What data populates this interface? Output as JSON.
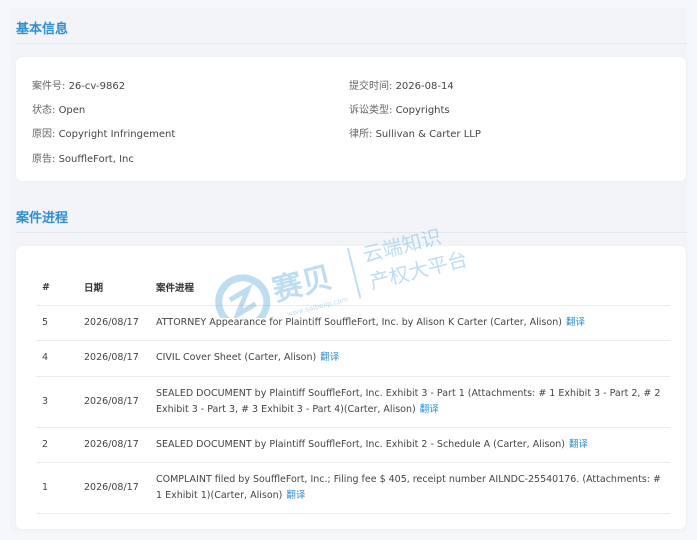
{
  "basic_info": {
    "title": "基本信息",
    "case_no": {
      "label": "案件号:",
      "value": "26-cv-9862"
    },
    "filed": {
      "label": "提交时间:",
      "value": "2026-08-14"
    },
    "status": {
      "label": "状态:",
      "value": "Open"
    },
    "suit_type": {
      "label": "诉讼类型:",
      "value": "Copyrights"
    },
    "cause": {
      "label": "原因:",
      "value": "Copyright Infringement"
    },
    "law_firm": {
      "label": "律所:",
      "value": "Sullivan & Carter LLP"
    },
    "plaintiff": {
      "label": "原告:",
      "value": "SouffleFort, Inc"
    }
  },
  "progress": {
    "title": "案件进程",
    "headers": {
      "num": "#",
      "date": "日期",
      "event": "案件进程"
    },
    "translate_label": "翻译",
    "rows": [
      {
        "num": "5",
        "date": "2026/08/17",
        "text": "ATTORNEY Appearance for Plaintiff SouffleFort, Inc. by Alison K Carter (Carter, Alison)"
      },
      {
        "num": "4",
        "date": "2026/08/17",
        "text": "CIVIL Cover Sheet (Carter, Alison)"
      },
      {
        "num": "3",
        "date": "2026/08/17",
        "text": "SEALED DOCUMENT by Plaintiff SouffleFort, Inc. Exhibit 3 - Part 1 (Attachments: # 1 Exhibit 3 - Part 2, # 2 Exhibit 3 - Part 3, # 3 Exhibit 3 - Part 4)(Carter, Alison)"
      },
      {
        "num": "2",
        "date": "2026/08/17",
        "text": "SEALED DOCUMENT by Plaintiff SouffleFort, Inc. Exhibit 2 - Schedule A (Carter, Alison)"
      },
      {
        "num": "1",
        "date": "2026/08/17",
        "text": "COMPLAINT filed by SouffleFort, Inc.; Filing fee $ 405, receipt number AILNDC-25540176. (Attachments: # 1 Exhibit 1)(Carter, Alison)"
      }
    ]
  },
  "watermark": {
    "brand": "赛贝",
    "tagline_1": "云端知识",
    "tagline_2": "产权大平台",
    "url": "www.saibeiip.com",
    "color": "#4a9fd8"
  }
}
